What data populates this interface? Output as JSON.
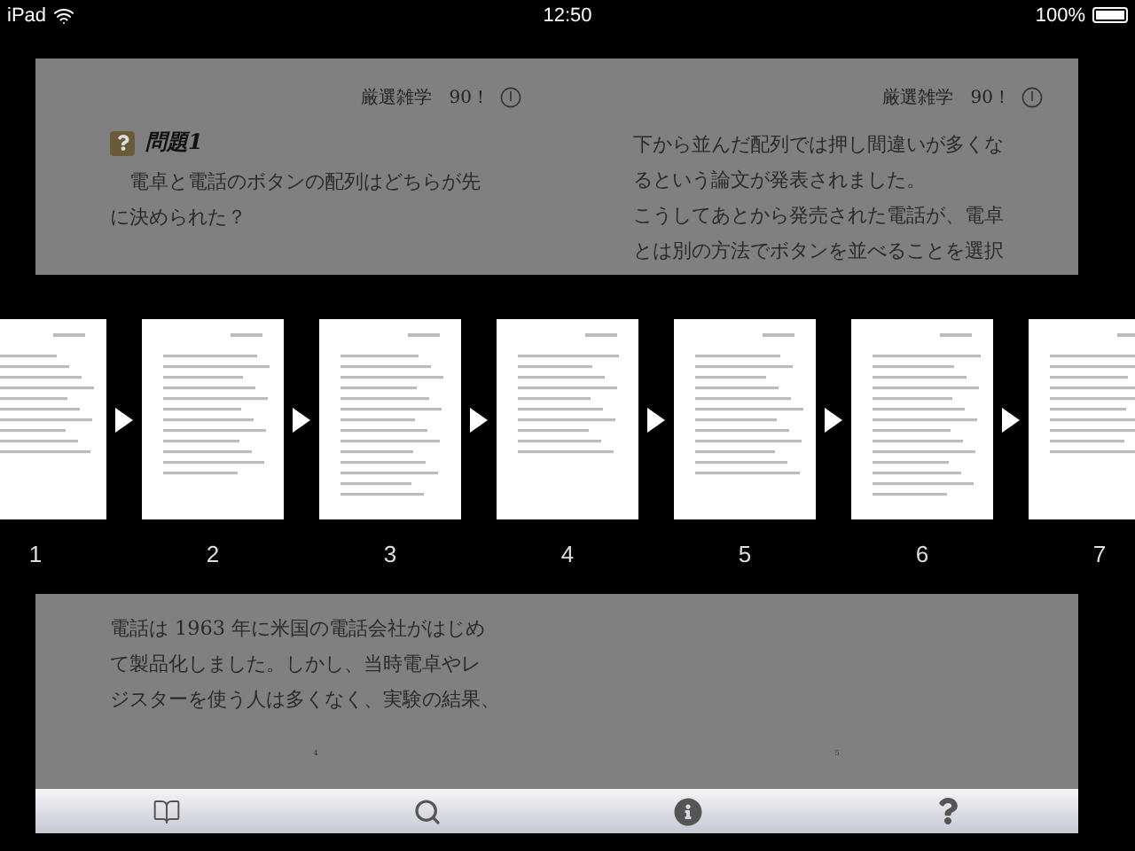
{
  "status_bar": {
    "device": "iPad",
    "time": "12:50",
    "battery": "100%"
  },
  "spread_top": {
    "left_page": {
      "header": "厳選雑学　90！",
      "heading": "問題1",
      "lines": [
        "　電卓と電話のボタンの配列はどちらが先",
        "に決められた？"
      ]
    },
    "right_page": {
      "header": "厳選雑学　90！",
      "lines": [
        "下から並んだ配列では押し間違いが多くな",
        "るという論文が発表されました。",
        "こうしてあとから発売された電話が、電卓",
        "とは別の方法でボタンを並べることを選択"
      ]
    }
  },
  "thumbnails": [
    {
      "label": "1"
    },
    {
      "label": "2"
    },
    {
      "label": "3"
    },
    {
      "label": "4"
    },
    {
      "label": "5"
    },
    {
      "label": "6"
    },
    {
      "label": "7"
    }
  ],
  "spread_bottom": {
    "left_page": {
      "lines": [
        "電話は 1963 年に米国の電話会社がはじめ",
        "て製品化しました。しかし、当時電卓やレ",
        "ジスターを使う人は多くなく、実験の結果、"
      ],
      "page_number": "4"
    },
    "right_page": {
      "page_number": "5"
    }
  },
  "toolbar": {
    "buttons": [
      {
        "kind": "contents"
      },
      {
        "kind": "search"
      },
      {
        "kind": "info"
      },
      {
        "kind": "help"
      }
    ]
  }
}
